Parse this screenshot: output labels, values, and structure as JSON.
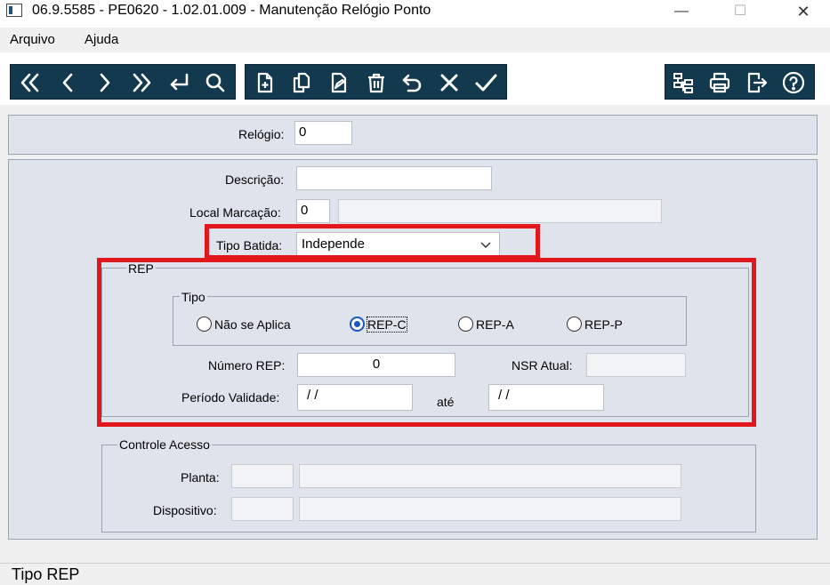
{
  "window": {
    "title": "06.9.5585 - PE0620 - 1.02.01.009 - Manutenção Relógio Ponto",
    "minimize": "—",
    "maximize": "☐",
    "close": "✕"
  },
  "menu": {
    "file": "Arquivo",
    "help": "Ajuda"
  },
  "toolbar": {
    "nav_icons": [
      "first-record-icon",
      "previous-record-icon",
      "next-record-icon",
      "last-record-icon",
      "goto-record-icon",
      "search-icon"
    ],
    "edit_icons": [
      "new-record-icon",
      "copy-record-icon",
      "edit-record-icon",
      "delete-record-icon",
      "undo-icon",
      "cancel-icon",
      "save-icon"
    ],
    "extra_icons": [
      "structure-icon",
      "print-icon",
      "exit-icon",
      "help-icon"
    ],
    "bg_color": "#12394d"
  },
  "header": {
    "relogio_label": "Relógio:",
    "relogio_value": "0"
  },
  "form": {
    "descricao_label": "Descrição:",
    "descricao_value": "",
    "local_label": "Local Marcação:",
    "local_value": "0",
    "local_desc": "",
    "tipo_batida_label": "Tipo Batida:",
    "tipo_batida_value": "Independe"
  },
  "rep": {
    "group_title": "REP",
    "tipo_title": "Tipo",
    "options": [
      "Não se Aplica",
      "REP-C",
      "REP-A",
      "REP-P"
    ],
    "selected": "REP-C",
    "numero_label": "Número REP:",
    "numero_value": "0",
    "nsr_label": "NSR Atual:",
    "nsr_value": "",
    "periodo_label": "Período Validade:",
    "periodo_from": "/ /",
    "ate_label": "até",
    "periodo_to": "/ /"
  },
  "controle": {
    "group_title": "Controle Acesso",
    "planta_label": "Planta:",
    "planta_code": "",
    "planta_desc": "",
    "dispositivo_label": "Dispositivo:",
    "dispositivo_code": "",
    "dispositivo_desc": ""
  },
  "status": {
    "text": "Tipo REP"
  },
  "highlight_color": "#e2171c"
}
